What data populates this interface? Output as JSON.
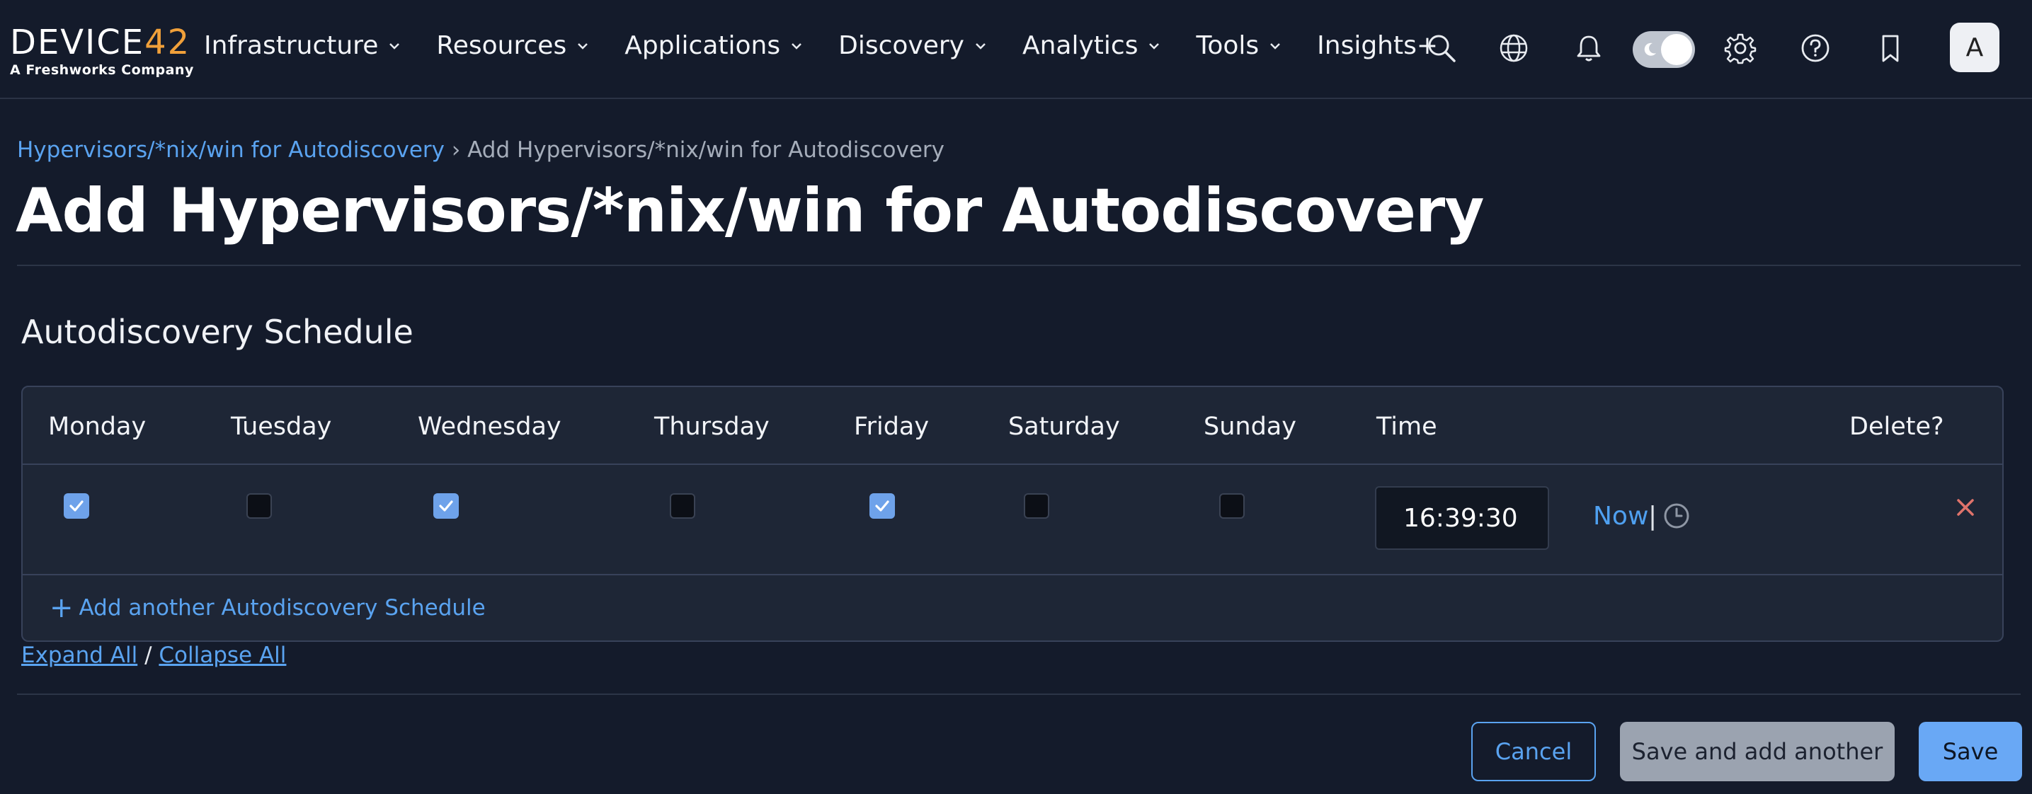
{
  "nav": {
    "logo_main": "DEVICE",
    "logo_num": "42",
    "logo_sub": "A Freshworks Company",
    "items": [
      {
        "label": "Infrastructure",
        "has_dropdown": true
      },
      {
        "label": "Resources",
        "has_dropdown": true
      },
      {
        "label": "Applications",
        "has_dropdown": true
      },
      {
        "label": "Discovery",
        "has_dropdown": true
      },
      {
        "label": "Analytics",
        "has_dropdown": true
      },
      {
        "label": "Tools",
        "has_dropdown": true
      },
      {
        "label": "Insights+",
        "has_dropdown": false
      }
    ],
    "icons": [
      "search-icon",
      "globe-icon",
      "bell-icon",
      "theme-toggle",
      "gear-icon",
      "help-icon",
      "bookmark-icon"
    ],
    "avatar_initial": "A"
  },
  "breadcrumb": {
    "parent": "Hypervisors/*nix/win for Autodiscovery",
    "separator": "›",
    "current": "Add Hypervisors/*nix/win for Autodiscovery"
  },
  "page_title": "Add Hypervisors/*nix/win for Autodiscovery",
  "section_title": "Autodiscovery Schedule",
  "schedule": {
    "columns": [
      "Monday",
      "Tuesday",
      "Wednesday",
      "Thursday",
      "Friday",
      "Saturday",
      "Sunday",
      "Time",
      "Delete?"
    ],
    "rows": [
      {
        "days": {
          "Monday": true,
          "Tuesday": false,
          "Wednesday": true,
          "Thursday": false,
          "Friday": true,
          "Saturday": false,
          "Sunday": false
        },
        "time": "16:39:30",
        "now_label": "Now",
        "separator": "|"
      }
    ],
    "add_label": "Add another Autodiscovery Schedule"
  },
  "expand": {
    "expand_all": "Expand All",
    "divider": "/",
    "collapse_all": "Collapse All"
  },
  "buttons": {
    "cancel": "Cancel",
    "save_add": "Save and add another",
    "save": "Save"
  },
  "colors": {
    "background": "#141b2b",
    "accent": "#5aa3f0",
    "logo_accent": "#f0a03a",
    "checkbox_checked": "#6ea2ea",
    "delete": "#e0736b"
  }
}
